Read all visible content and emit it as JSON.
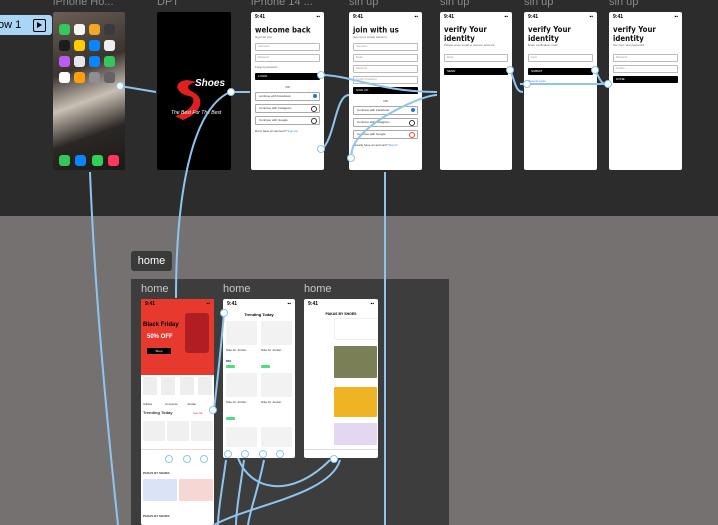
{
  "flow": {
    "label": "ow 1"
  },
  "frames": {
    "iphone_home": {
      "label": "iPhone Ho..."
    },
    "dpt": {
      "label": "DPT",
      "brand": "Shoes",
      "slogan": "The Best For The Best"
    },
    "login": {
      "label": "iPhone 14 ...",
      "time": "9:41",
      "title": "welcome back",
      "sub": "sign into you",
      "email": "Username",
      "password": "Password",
      "forgot": "Forgot password",
      "button": "LOGIN",
      "or": "OR",
      "fb": "continue with Facebook",
      "ig": "Continue with Instagram",
      "google": "Continue with Google",
      "footer": "Don't have an account?",
      "footer_link": "Sign Up"
    },
    "signup1": {
      "label": "sin up",
      "time": "9:41",
      "title": "join with us",
      "sub": "sign up to create account",
      "f1": "Username",
      "f2": "Email",
      "f3": "Password",
      "f4": "Confirm Password",
      "button": "SIGN UP",
      "or": "OR",
      "fb": "Continue with Facebook",
      "ig": "Continue with Instagram",
      "google": "Continue with Google",
      "footer": "Already have an account?",
      "footer_link": "Sign In"
    },
    "signup2": {
      "label": "sin up",
      "time": "9:41",
      "title": "verify Your identity",
      "sub": "Please enter email to recover account",
      "f1": "Email",
      "button": "SEND"
    },
    "signup3": {
      "label": "sin up",
      "time": "9:41",
      "title": "verify Your identity",
      "sub": "Enter verification code",
      "f1": "Code",
      "button": "SUBMIT",
      "footer": "Resend code"
    },
    "signup4": {
      "label": "sin up",
      "time": "9:41",
      "title": "verify Your identity",
      "sub": "Set your new password",
      "f1": "Password",
      "f2": "Confirm",
      "button": "DONE"
    }
  },
  "home_section": {
    "label": "home",
    "frames": [
      {
        "label": "home",
        "time": "9:41",
        "banner": "Black Friday",
        "discount": "50% OFF",
        "cta": "Shop",
        "cats": [
          "Adidas",
          "Converse",
          "Jordan",
          "All"
        ],
        "trending": "Trending Today",
        "see_all": "See All",
        "section2": "PAKAS BY SHOES",
        "section3": "PAKAS BY SHOES"
      },
      {
        "label": "home",
        "time": "9:41",
        "title": "Trending Today",
        "item": "Nike Air Jordan",
        "price": "$59"
      },
      {
        "label": "home",
        "time": "9:41",
        "title": "PAKAS BY SHOES"
      }
    ]
  },
  "colors": {
    "accent": "#8ec5f0",
    "banner": "#e8392e"
  }
}
